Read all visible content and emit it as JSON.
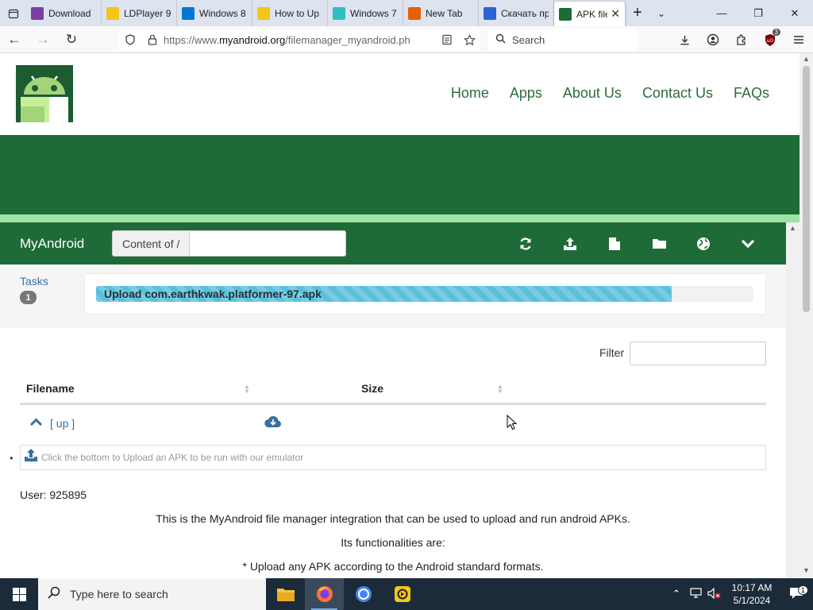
{
  "browser": {
    "tabs": [
      {
        "label": "Download",
        "favicon": "MX",
        "favicon_color": "#7a3fa3"
      },
      {
        "label": "LDPlayer 9",
        "favicon": "LD",
        "favicon_color": "#f5c518"
      },
      {
        "label": "Windows 8",
        "favicon": "win",
        "favicon_color": "#0078d4"
      },
      {
        "label": "How to Up",
        "favicon": "LD",
        "favicon_color": "#f5c518"
      },
      {
        "label": "Windows 7",
        "favicon": "W7",
        "favicon_color": "#2cc0c0"
      },
      {
        "label": "New Tab",
        "favicon": "ff",
        "favicon_color": "#e66000"
      },
      {
        "label": "Скачать пр",
        "favicon": "T",
        "favicon_color": "#2a63d8"
      },
      {
        "label": "APK file",
        "favicon": "apk",
        "favicon_color": "#1e6b37",
        "active": true
      }
    ],
    "url_prefix": "https://www.",
    "url_host": "myandroid.org",
    "url_path": "/filemanager_myandroid.ph",
    "search_placeholder": "Search",
    "ublock_badge": "3"
  },
  "site": {
    "nav": [
      "Home",
      "Apps",
      "About Us",
      "Contact Us",
      "FAQs"
    ]
  },
  "filemanager": {
    "title": "MyAndroid",
    "path_label": "Content of /",
    "path_value": "",
    "tasks_label": "Tasks",
    "tasks_count": "1",
    "upload_task_text": "Upload com.earthkwak.platformer-97.apk",
    "upload_progress": 0.875,
    "filter_label": "Filter",
    "filter_value": "",
    "columns": [
      "Filename",
      "Size"
    ],
    "up_label": "[ up ]",
    "upload_hint": "Click the bottom to Upload an APK to be run with our emulator",
    "user_line": "User: 925895",
    "description": [
      "This is the MyAndroid file manager integration that can be used to upload and run android APKs.",
      "Its functionalities are:",
      "* Upload any APK according to the Android standard formats."
    ]
  },
  "taskbar": {
    "search_placeholder": "Type here to search",
    "time": "10:17 AM",
    "date": "5/1/2024",
    "notification_count": "1"
  },
  "colors": {
    "site_green": "#1e6b37",
    "stripe_light_green": "#9ee2a7",
    "link_blue": "#3a6fa0",
    "progress_blue": "#5bc0de"
  }
}
